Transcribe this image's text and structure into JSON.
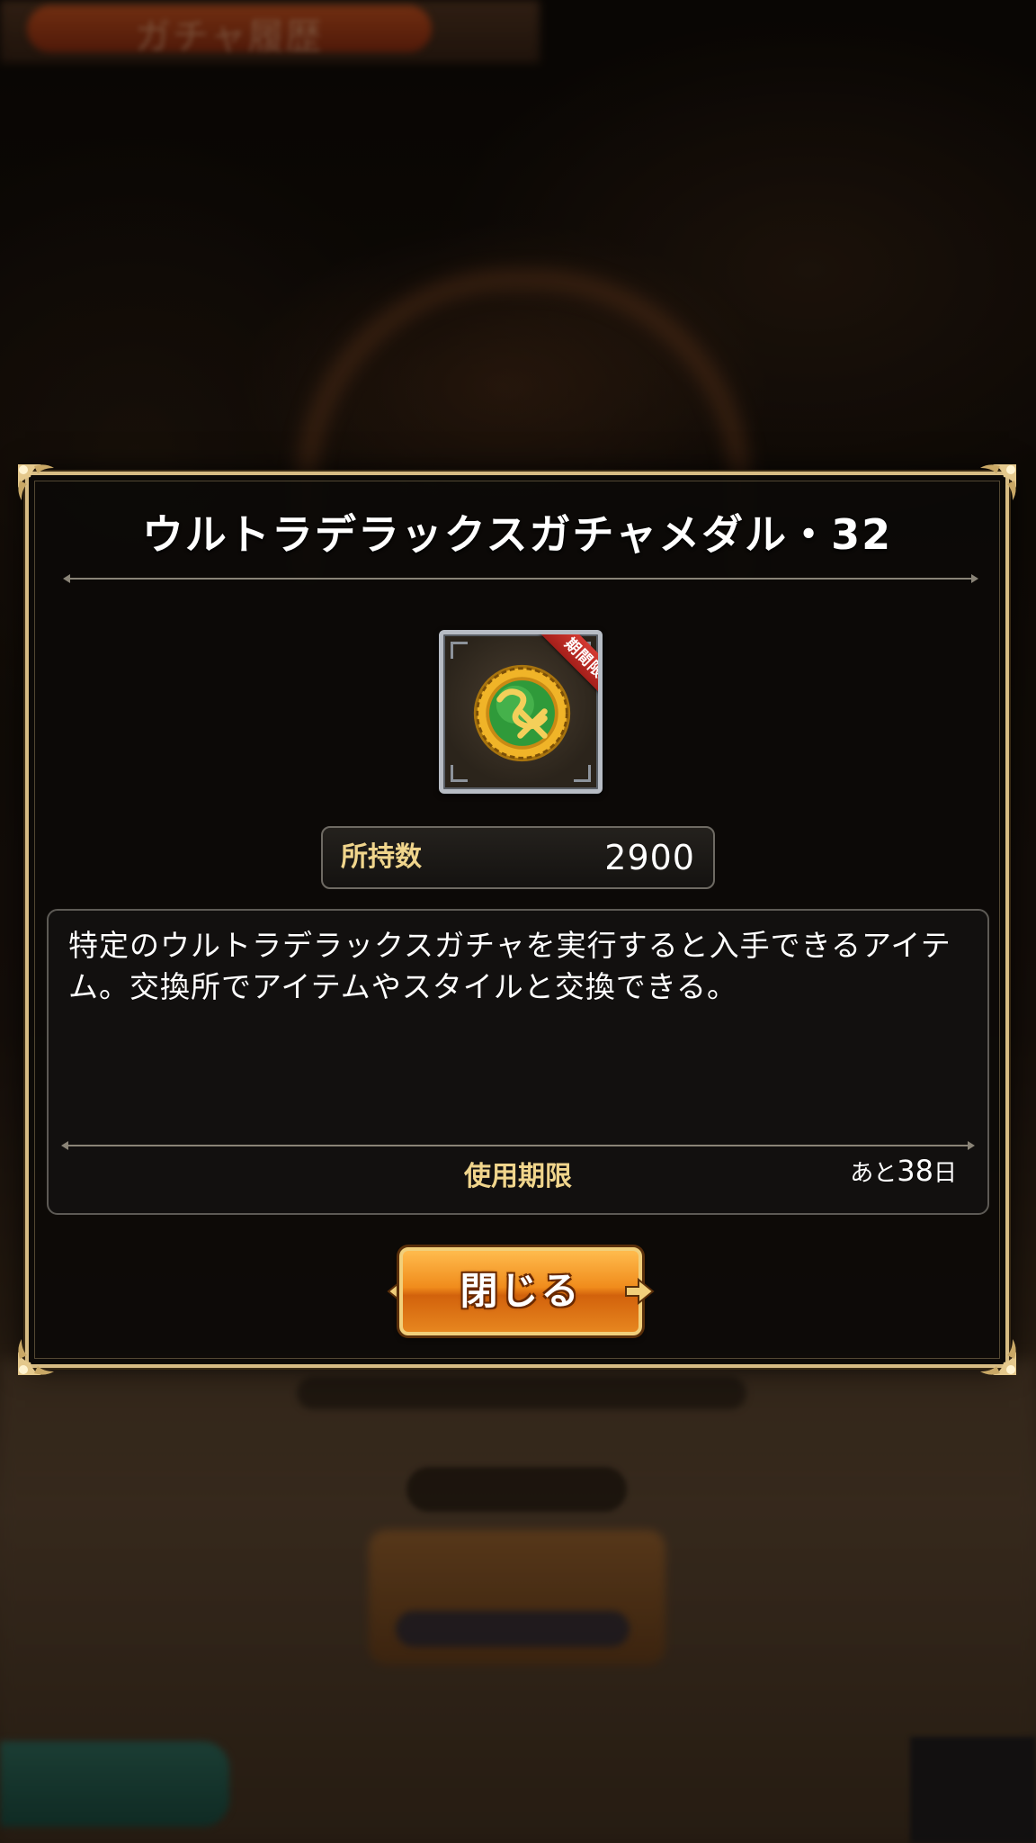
{
  "background": {
    "header_title": "ガチャ履歴"
  },
  "dialog": {
    "title": "ウルトラデラックスガチャメダル・32",
    "item": {
      "icon": "gacha-medal-icon",
      "badge": "期間限定"
    },
    "owned": {
      "label": "所持数",
      "value": "2900"
    },
    "description": "特定のウルトラデラックスガチャを実行すると入手できるアイテム。交換所でアイテムやスタイルと交換できる。",
    "expiry": {
      "label": "使用期限",
      "prefix": "あと",
      "days": "38",
      "unit": "日"
    },
    "close_button_label": "閉じる"
  },
  "colors": {
    "frame_gold": "#d7bc84",
    "label_gold": "#f0d58c",
    "button_orange": "#f08c1c",
    "badge_red": "#c42e28",
    "medal_green": "#2f9a3a"
  }
}
